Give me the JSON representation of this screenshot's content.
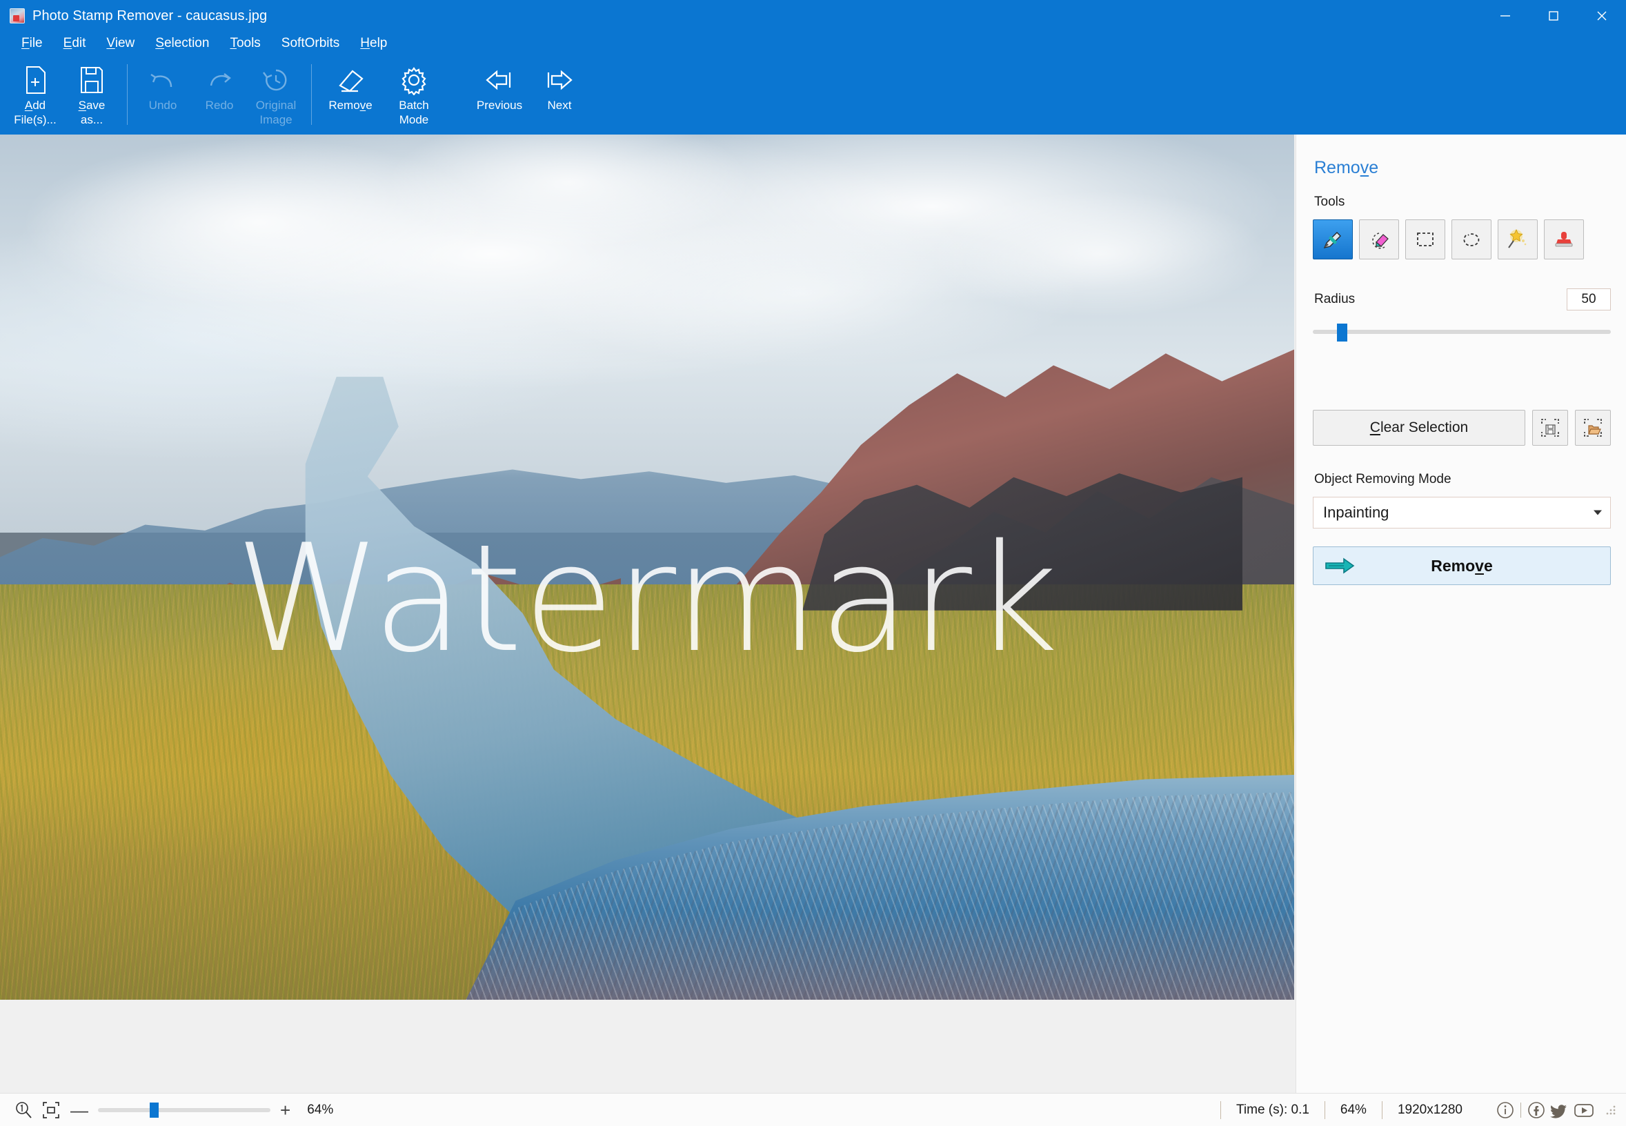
{
  "window": {
    "title": "Photo Stamp Remover - caucasus.jpg",
    "icon": "app-photo-icon",
    "minimize": "–",
    "maximize": "□",
    "close": "✕",
    "titlebar_color": "#0b76d1"
  },
  "menubar": {
    "items": [
      {
        "label": "File",
        "accel": "F"
      },
      {
        "label": "Edit",
        "accel": "E"
      },
      {
        "label": "View",
        "accel": "V"
      },
      {
        "label": "Selection",
        "accel": "S"
      },
      {
        "label": "Tools",
        "accel": "T"
      },
      {
        "label": "SoftOrbits",
        "accel": ""
      },
      {
        "label": "Help",
        "accel": "H"
      }
    ]
  },
  "toolbar": {
    "add_files": "Add\nFile(s)...",
    "save_as": "Save\nas...",
    "undo": "Undo",
    "redo": "Redo",
    "original_image": "Original\nImage",
    "remove": "Remove",
    "batch_mode": "Batch\nMode",
    "previous": "Previous",
    "next": "Next"
  },
  "panel": {
    "title": "Remove",
    "tools_label": "Tools",
    "tools": [
      {
        "name": "marker-tool",
        "selected": true
      },
      {
        "name": "eraser-tool",
        "selected": false
      },
      {
        "name": "rectangle-select-tool",
        "selected": false
      },
      {
        "name": "lasso-select-tool",
        "selected": false
      },
      {
        "name": "magic-wand-tool",
        "selected": false
      },
      {
        "name": "stamp-tool",
        "selected": false
      }
    ],
    "radius_label": "Radius",
    "radius_value": "50",
    "radius_slider_pct": 8,
    "clear_selection": "Clear Selection",
    "save_selection_icon": "save-selection-icon",
    "load_selection_icon": "load-selection-icon",
    "mode_label": "Object Removing Mode",
    "mode_value": "Inpainting",
    "remove_button": "Remove",
    "accent_color": "#2a7fd4"
  },
  "canvas": {
    "image_name": "caucasus.jpg",
    "watermark_text": "Watermark"
  },
  "statusbar": {
    "zoom_1to1_icon": "zoom-actual-size-icon",
    "fit_icon": "zoom-fit-icon",
    "minus": "—",
    "plus": "+",
    "zoom_slider_pct": 30,
    "zoom_left": "64%",
    "time": "Time (s): 0.1",
    "zoom_right": "64%",
    "dimensions": "1920x1280",
    "social": [
      "info-icon",
      "facebook-icon",
      "twitter-icon",
      "youtube-icon"
    ]
  }
}
